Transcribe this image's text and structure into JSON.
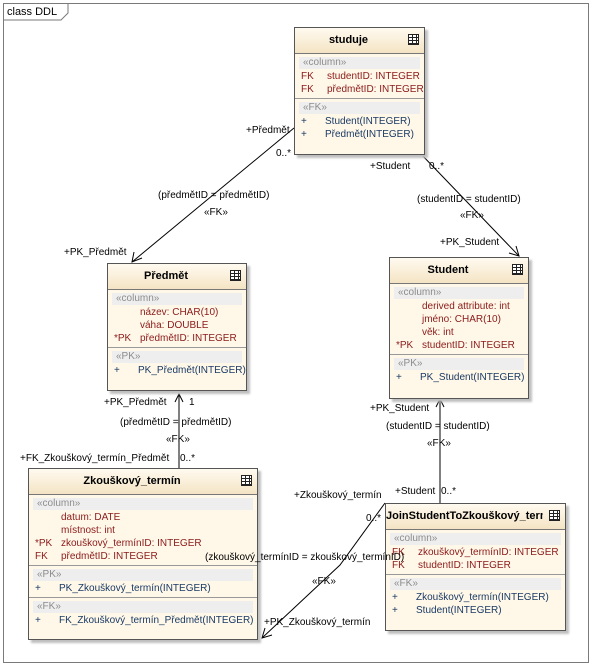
{
  "frame": {
    "label": "class DDL"
  },
  "tables": {
    "studuje": {
      "name": "studuje",
      "column_stereotype": "«column»",
      "columns": [
        {
          "prefix": "FK",
          "text": "studentID:  INTEGER"
        },
        {
          "prefix": "FK",
          "text": "předmětID:  INTEGER"
        }
      ],
      "op_stereotype": "«FK»",
      "operations": [
        {
          "sign": "+",
          "text": "Student(INTEGER)"
        },
        {
          "sign": "+",
          "text": "Předmět(INTEGER)"
        }
      ]
    },
    "predmet": {
      "name": "Předmět",
      "column_stereotype": "«column»",
      "columns": [
        {
          "prefix": "",
          "text": "název:  CHAR(10)"
        },
        {
          "prefix": "",
          "text": "váha:  DOUBLE"
        },
        {
          "prefix": "*PK",
          "text": "předmětID:  INTEGER"
        }
      ],
      "op_stereotype": "«PK»",
      "operations": [
        {
          "sign": "+",
          "text": "PK_Předmět(INTEGER)"
        }
      ]
    },
    "student": {
      "name": "Student",
      "column_stereotype": "«column»",
      "columns": [
        {
          "prefix": "",
          "text": "derived attribute:  int"
        },
        {
          "prefix": "",
          "text": "jméno:  CHAR(10)"
        },
        {
          "prefix": "",
          "text": "věk:  int"
        },
        {
          "prefix": "*PK",
          "text": "studentID:  INTEGER"
        }
      ],
      "op_stereotype": "«PK»",
      "operations": [
        {
          "sign": "+",
          "text": "PK_Student(INTEGER)"
        }
      ]
    },
    "zkouskovy": {
      "name": "Zkouškový_termín",
      "column_stereotype": "«column»",
      "columns": [
        {
          "prefix": "",
          "text": "datum:  DATE"
        },
        {
          "prefix": "",
          "text": "místnost:  int"
        },
        {
          "prefix": "*PK",
          "text": "zkouškový_termínID:  INTEGER"
        },
        {
          "prefix": "FK",
          "text": "předmětID:  INTEGER"
        }
      ],
      "op_stereotype": "«PK»",
      "operations": [
        {
          "sign": "+",
          "text": "PK_Zkouškový_termín(INTEGER)"
        }
      ],
      "op_stereotype_2": "«FK»",
      "operations_2": [
        {
          "sign": "+",
          "text": "FK_Zkouškový_termín_Předmět(INTEGER)"
        }
      ]
    },
    "join": {
      "name": "JoinStudentToZkouškový_termín",
      "column_stereotype": "«column»",
      "columns": [
        {
          "prefix": "FK",
          "text": "zkouškový_termínID:  INTEGER"
        },
        {
          "prefix": "FK",
          "text": "studentID:  INTEGER"
        }
      ],
      "op_stereotype": "«FK»",
      "operations": [
        {
          "sign": "+",
          "text": "Zkouškový_termín(INTEGER)"
        },
        {
          "sign": "+",
          "text": "Student(INTEGER)"
        }
      ]
    }
  },
  "connectors": {
    "c1": {
      "role_src": "+Předmět",
      "mult_src": "0..*",
      "cond": "(předmětID = předmětID)",
      "stereo": "«FK»",
      "role_dst": "+PK_Předmět"
    },
    "c2": {
      "role_src": "+Student",
      "mult_src": "0..*",
      "cond": "(studentID = studentID)",
      "stereo": "«FK»",
      "role_dst": "+PK_Student"
    },
    "c3": {
      "role_dst": "+PK_Předmět",
      "mult_dst": "1",
      "cond": "(předmětID = předmětID)",
      "stereo": "«FK»",
      "role_src": "+FK_Zkouškový_termín_Předmět",
      "mult_src": "0..*"
    },
    "c4": {
      "role_dst": "+PK_Student",
      "cond": "(studentID = studentID)",
      "stereo": "«FK»",
      "role_src": "+Student",
      "mult_src": "0..*"
    },
    "c5": {
      "role_src": "+Zkouškový_termín",
      "mult_src": "0..*",
      "cond": "(zkouškový_termínID = zkouškový_termínID)",
      "stereo": "«FK»",
      "role_dst": "+PK_Zkouškový_termín"
    }
  }
}
